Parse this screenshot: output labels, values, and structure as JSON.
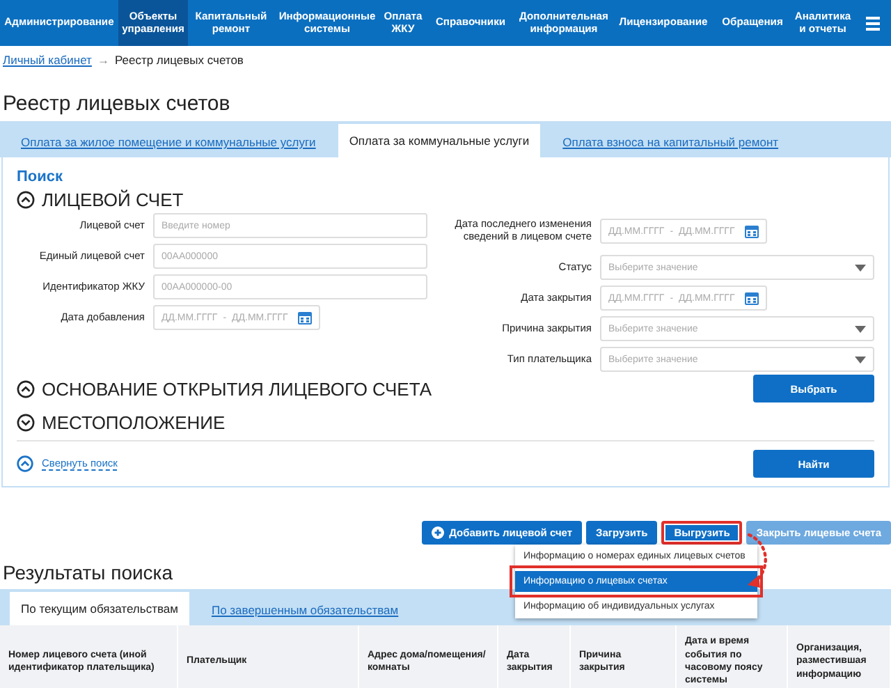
{
  "nav": {
    "items": [
      {
        "label": "Администрирование",
        "selected": false
      },
      {
        "label": "Объекты управления",
        "selected": true
      },
      {
        "label": "Капитальный ремонт",
        "selected": false
      },
      {
        "label": "Информационные системы",
        "selected": false
      },
      {
        "label": "Оплата ЖКУ",
        "selected": false
      },
      {
        "label": "Справочники",
        "selected": false
      },
      {
        "label": "Дополнительная информация",
        "selected": false
      },
      {
        "label": "Лицензирование",
        "selected": false
      },
      {
        "label": "Обращения",
        "selected": false
      },
      {
        "label": "Аналитика и отчеты",
        "selected": false
      }
    ]
  },
  "breadcrumb": {
    "link": "Личный кабинет",
    "separator": "→",
    "current": "Реестр лицевых счетов"
  },
  "page_title": "Реестр лицевых счетов",
  "tabs": [
    {
      "label": "Оплата за жилое помещение и коммунальные услуги",
      "selected": false
    },
    {
      "label": "Оплата за коммунальные услуги",
      "selected": true
    },
    {
      "label": "Оплата взноса на капитальный ремонт",
      "selected": false
    }
  ],
  "search": {
    "title": "Поиск",
    "section": {
      "title": "ЛИЦЕВОЙ СЧЕТ",
      "expanded": true
    },
    "left_fields": [
      {
        "label": "Лицевой счет",
        "kind": "text",
        "placeholder": "Введите номер"
      },
      {
        "label": "Единый лицевой счет",
        "kind": "text",
        "placeholder": "00АА000000"
      },
      {
        "label": "Идентификатор ЖКУ",
        "kind": "text",
        "placeholder": "00АА000000-00"
      },
      {
        "label": "Дата добавления",
        "kind": "daterange",
        "placeholder": "ДД.ММ.ГГГГ",
        "separator": "-",
        "placeholder_to": "ДД.ММ.ГГГГ"
      }
    ],
    "right_fields": [
      {
        "label": "Дата последнего изменения сведений в лицевом счете",
        "kind": "daterange",
        "placeholder": "ДД.ММ.ГГГГ",
        "separator": "-",
        "placeholder_to": "ДД.ММ.ГГГГ"
      },
      {
        "label": "Статус",
        "kind": "select",
        "placeholder": "Выберите значение"
      },
      {
        "label": "Дата закрытия",
        "kind": "daterange",
        "placeholder": "ДД.ММ.ГГГГ",
        "separator": "-",
        "placeholder_to": "ДД.ММ.ГГГГ"
      },
      {
        "label": "Причина закрытия",
        "kind": "select",
        "placeholder": "Выберите значение"
      },
      {
        "label": "Тип плательщика",
        "kind": "select",
        "placeholder": "Выберите значение"
      }
    ],
    "sections": [
      {
        "title": "ОСНОВАНИЕ ОТКРЫТИЯ ЛИЦЕВОГО СЧЕТА",
        "expanded": true,
        "button": "Выбрать"
      },
      {
        "title": "МЕСТОПОЛОЖЕНИЕ",
        "expanded": false
      }
    ],
    "collapse_link": "Свернуть поиск",
    "find_button": "Найти"
  },
  "actions": [
    {
      "label": "Добавить лицевой счет",
      "kind": "add",
      "highlighted": false,
      "disabled": false
    },
    {
      "label": "Загрузить",
      "kind": "plain",
      "highlighted": false,
      "disabled": false
    },
    {
      "label": "Выгрузить",
      "kind": "plain",
      "highlighted": true,
      "disabled": false
    },
    {
      "label": "Закрыть лицевые счета",
      "kind": "plain",
      "highlighted": false,
      "disabled": true
    }
  ],
  "export_menu": [
    {
      "label": "Информацию о номерах единых лицевых счетов",
      "selected": false
    },
    {
      "label": "Информацию о лицевых счетах",
      "selected": true
    },
    {
      "label": "Информацию об индивидуальных услугах",
      "selected": false
    }
  ],
  "results": {
    "title": "Результаты поиска",
    "tabs": [
      {
        "label": "По текущим обязательствам",
        "selected": true
      },
      {
        "label": "По завершенным обязательствам",
        "selected": false
      }
    ],
    "columns": [
      "Номер лицевого счета (иной идентификатор плательщика)",
      "Плательщик",
      "Адрес дома/помещения/комнаты",
      "Дата закрытия",
      "Причина закрытия",
      "Дата и время события по часовому поясу системы",
      "Организация, разместившая информацию"
    ]
  }
}
